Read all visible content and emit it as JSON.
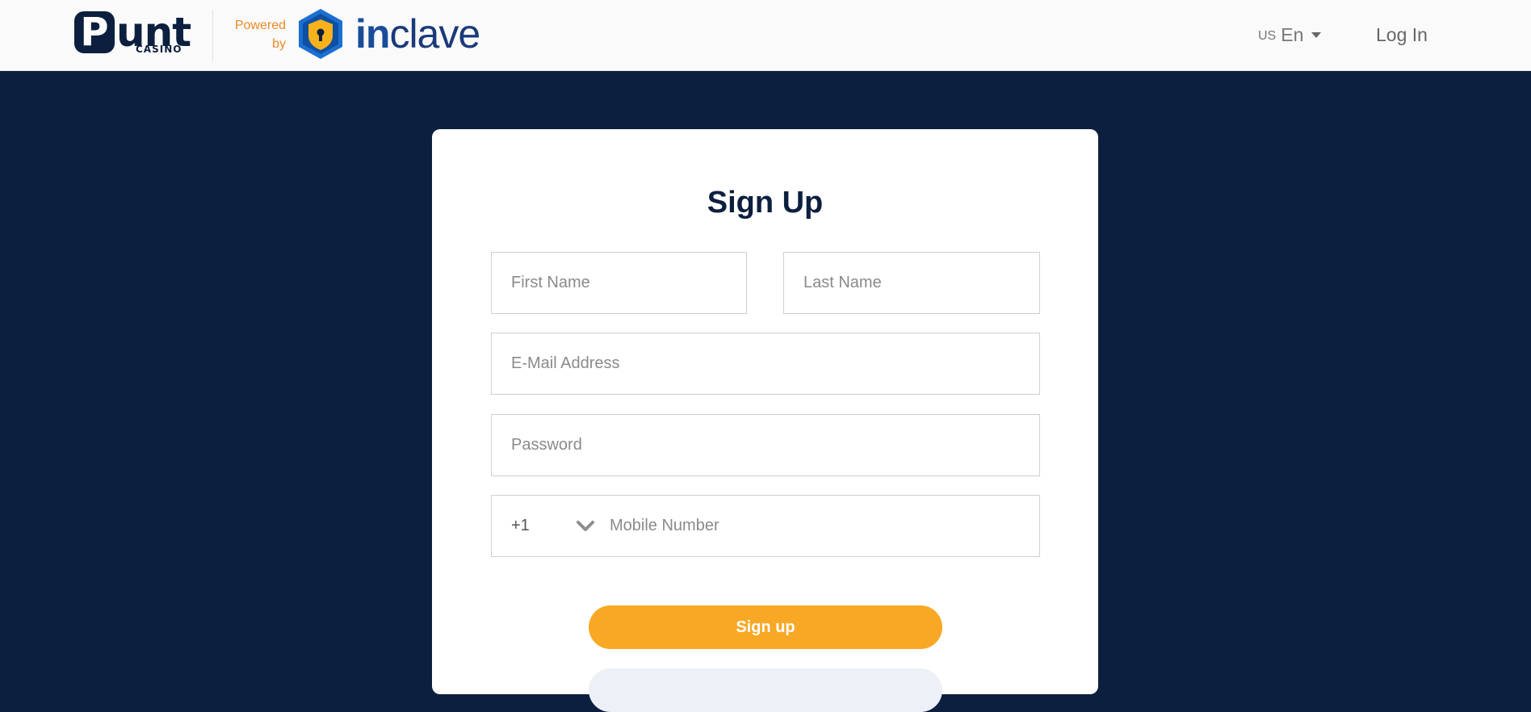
{
  "header": {
    "logo_main": "unt",
    "logo_p": "P",
    "logo_sub": "CASINO",
    "powered_line1": "Powered",
    "powered_line2": "by",
    "partner_in": "in",
    "partner_rest": "clave",
    "lang_flag": "US",
    "lang_code": "En",
    "login_label": "Log In"
  },
  "form": {
    "title": "Sign Up",
    "first_name_placeholder": "First Name",
    "last_name_placeholder": "Last Name",
    "email_placeholder": "E-Mail Address",
    "password_placeholder": "Password",
    "country_code": "+1",
    "mobile_placeholder": "Mobile Number",
    "signup_label": "Sign up"
  },
  "colors": {
    "navy": "#0c1f3f",
    "accent": "#f9a825",
    "powered_orange": "#f08a24",
    "partner_blue": "#1b4c9a"
  },
  "icons": {
    "country_dropdown": "chevron-down-icon",
    "lang_caret": "caret-down-icon",
    "partner_logo": "shield-lock-icon"
  }
}
